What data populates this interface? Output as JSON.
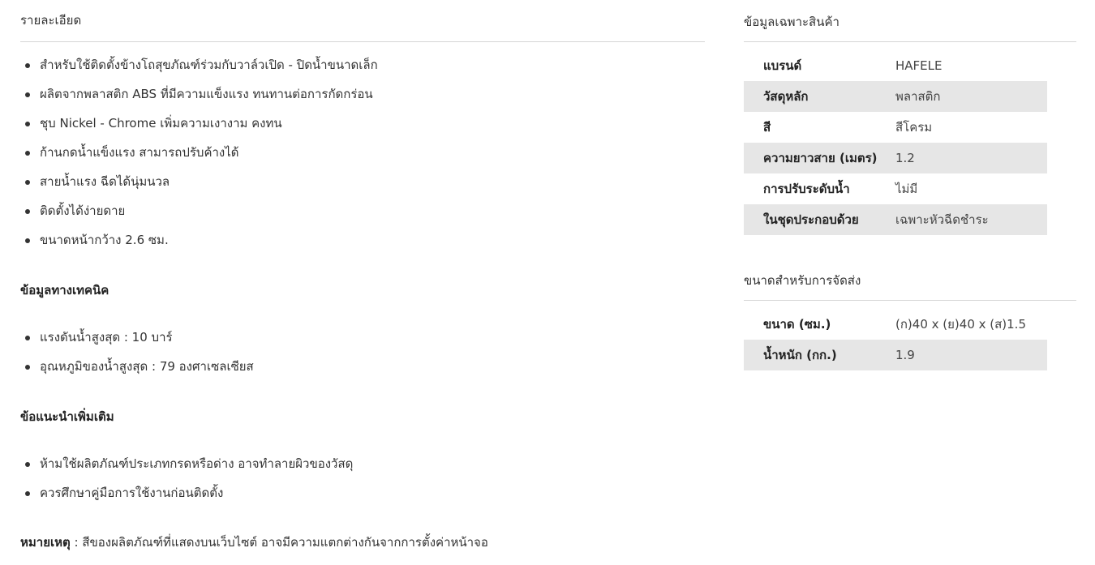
{
  "details": {
    "title": "รายละเอียด",
    "features": [
      "สำหรับใช้ติดตั้งข้างโถสุขภัณฑ์ร่วมกับวาล์วเปิด - ปิดน้ำขนาดเล็ก",
      "ผลิตจากพลาสติก ABS ที่มีความแข็งแรง ทนทานต่อการกัดกร่อน",
      "ชุบ Nickel - Chrome เพิ่มความเงางาม คงทน",
      "ก้านกดน้ำแข็งแรง สามารถปรับค้างได้",
      "สายน้ำแรง ฉีดได้นุ่มนวล",
      "ติดตั้งได้ง่ายดาย",
      "ขนาดหน้ากว้าง 2.6 ซม."
    ],
    "technical": {
      "heading": "ข้อมูลทางเทคนิค",
      "items": [
        "แรงดันน้ำสูงสุด : 10 บาร์",
        "อุณหภูมิของน้ำสูงสุด : 79 องศาเซลเซียส"
      ]
    },
    "advice": {
      "heading": "ข้อแนะนำเพิ่มเติม",
      "items": [
        "ห้ามใช้ผลิตภัณฑ์ประเภทกรดหรือด่าง อาจทำลายผิวของวัสดุ",
        "ควรศึกษาคู่มือการใช้งานก่อนติดตั้ง"
      ]
    },
    "note": {
      "label": "หมายเหตุ",
      "text": " : สีของผลิตภัณฑ์ที่แสดงบนเว็บไซต์ อาจมีความแตกต่างกันจากการตั้งค่าหน้าจอ"
    }
  },
  "specs": {
    "title": "ข้อมูลเฉพาะสินค้า",
    "rows": [
      {
        "key": "แบรนด์",
        "value": "HAFELE"
      },
      {
        "key": "วัสดุหลัก",
        "value": "พลาสติก"
      },
      {
        "key": "สี",
        "value": "สีโครม"
      },
      {
        "key": "ความยาวสาย (เมตร)",
        "value": "1.2"
      },
      {
        "key": "การปรับระดับน้ำ",
        "value": "ไม่มี"
      },
      {
        "key": "ในชุดประกอบด้วย",
        "value": "เฉพาะหัวฉีดชำระ"
      }
    ]
  },
  "shipping": {
    "title": "ขนาดสำหรับการจัดส่ง",
    "rows": [
      {
        "key": "ขนาด (ซม.)",
        "value": "(ก)40 x (ย)40 x (ส)1.5"
      },
      {
        "key": "น้ำหนัก (กก.)",
        "value": "1.9"
      }
    ]
  }
}
